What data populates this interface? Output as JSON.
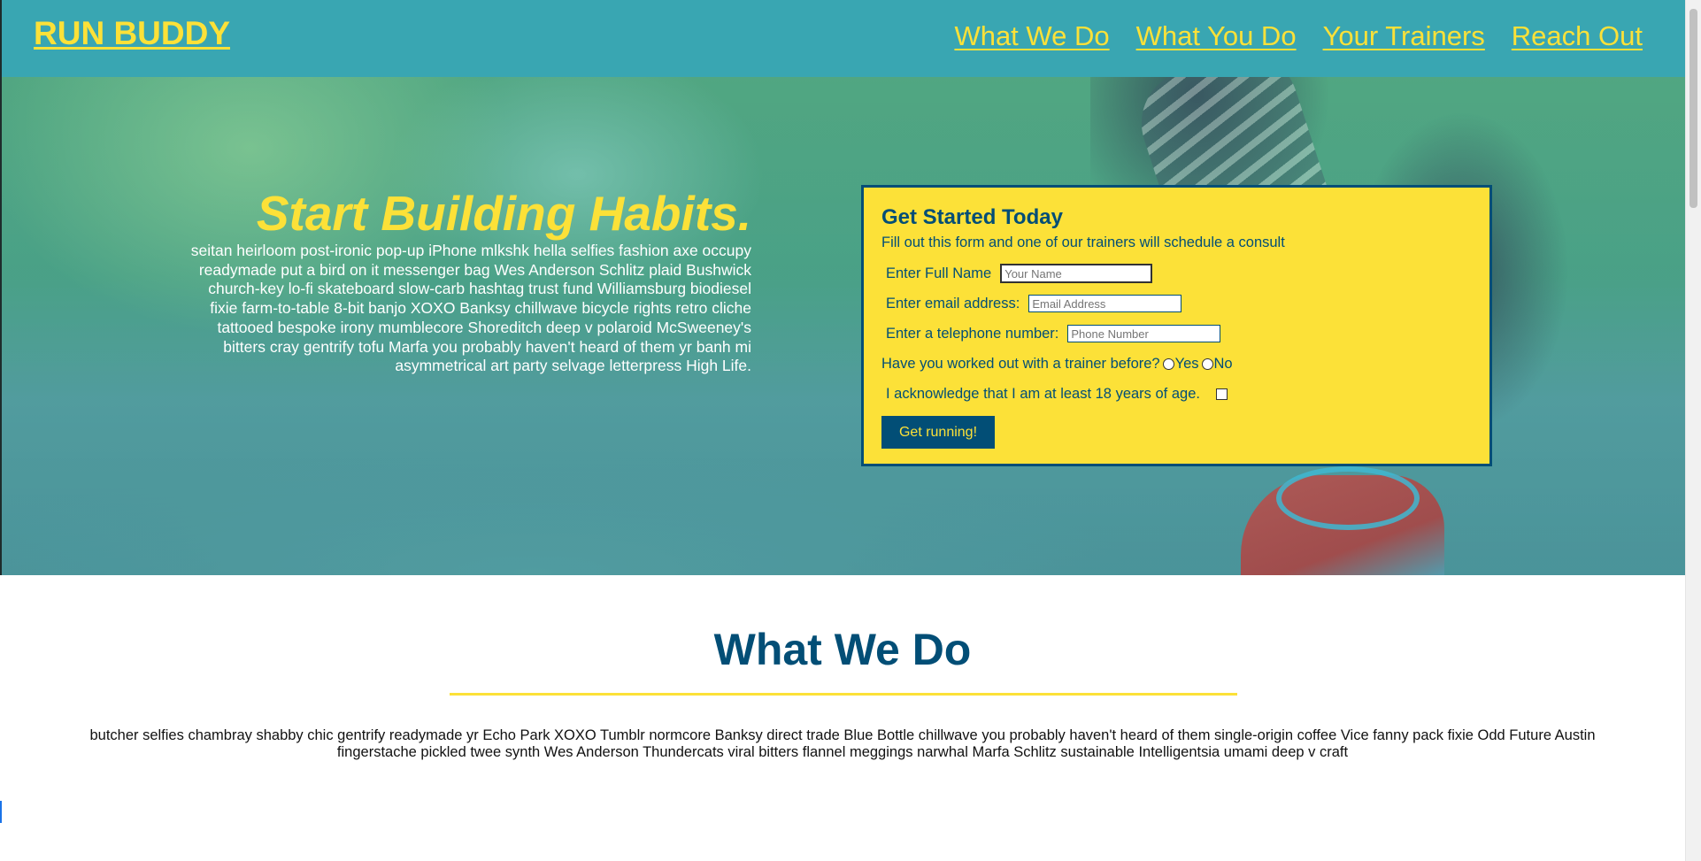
{
  "header": {
    "logo": "RUN BUDDY",
    "nav": [
      "What We Do",
      "What You Do",
      "Your Trainers",
      "Reach Out"
    ]
  },
  "hero": {
    "title": "Start Building Habits.",
    "body": "seitan heirloom post-ironic pop-up iPhone mlkshk hella selfies fashion axe occupy readymade put a bird on it messenger bag Wes Anderson Schlitz plaid Bushwick church-key lo-fi skateboard slow-carb hashtag trust fund Williamsburg biodiesel fixie farm-to-table 8-bit banjo XOXO Banksy chillwave bicycle rights retro cliche tattooed bespoke irony mumblecore Shoreditch deep v polaroid McSweeney's bitters cray gentrify tofu Marfa you probably haven't heard of them yr banh mi asymmetrical art party selvage letterpress High Life."
  },
  "form": {
    "title": "Get Started Today",
    "subtitle": "Fill out this form and one of our trainers will schedule a consult",
    "name_label": "Enter Full Name",
    "name_placeholder": "Your Name",
    "email_label": "Enter email address:",
    "email_placeholder": "Email Address",
    "phone_label": "Enter a telephone number:",
    "phone_placeholder": "Phone Number",
    "trainer_question": "Have you worked out with a trainer before?",
    "yes": "Yes",
    "no": "No",
    "age_label": "I acknowledge that I am at least 18 years of age.",
    "submit": "Get running!"
  },
  "what_we_do": {
    "title": "What We Do",
    "body": "butcher selfies chambray shabby chic gentrify readymade yr Echo Park XOXO Tumblr normcore Banksy direct trade Blue Bottle chillwave you probably haven't heard of them single-origin coffee Vice fanny pack fixie Odd Future Austin fingerstache pickled twee synth Wes Anderson Thundercats viral bitters flannel meggings narwhal Marfa Schlitz sustainable Intelligentsia umami deep v craft"
  },
  "colors": {
    "primary": "#39a6b2",
    "accent": "#fce138",
    "dark": "#024e76"
  }
}
